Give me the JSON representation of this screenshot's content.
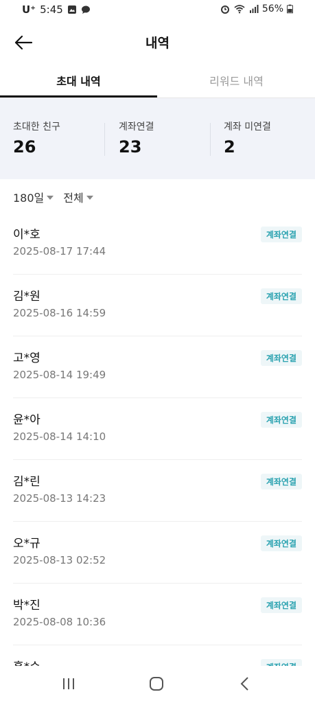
{
  "status_bar": {
    "carrier": "U⁺",
    "time": "5:45",
    "battery": "56%"
  },
  "header": {
    "title": "내역"
  },
  "tabs": [
    {
      "label": "초대 내역",
      "active": true
    },
    {
      "label": "리워드 내역",
      "active": false
    }
  ],
  "summary": [
    {
      "label": "초대한 친구",
      "value": "26"
    },
    {
      "label": "계좌연결",
      "value": "23"
    },
    {
      "label": "계좌 미연결",
      "value": "2"
    }
  ],
  "filters": {
    "period": "180일",
    "type": "전체"
  },
  "invites": [
    {
      "name": "이*호",
      "date": "2025-08-17 17:44",
      "badge": "계좌연결"
    },
    {
      "name": "김*원",
      "date": "2025-08-16 14:59",
      "badge": "계좌연결"
    },
    {
      "name": "고*영",
      "date": "2025-08-14 19:49",
      "badge": "계좌연결"
    },
    {
      "name": "윤*아",
      "date": "2025-08-14 14:10",
      "badge": "계좌연결"
    },
    {
      "name": "김*린",
      "date": "2025-08-13 14:23",
      "badge": "계좌연결"
    },
    {
      "name": "오*규",
      "date": "2025-08-13 02:52",
      "badge": "계좌연결"
    },
    {
      "name": "박*진",
      "date": "2025-08-08 10:36",
      "badge": "계좌연결"
    },
    {
      "name": "홍*수",
      "date": "",
      "badge": "계좌연결"
    }
  ],
  "colors": {
    "accent": "#2aa2b0",
    "summary_bg": "#f1f3f9"
  }
}
